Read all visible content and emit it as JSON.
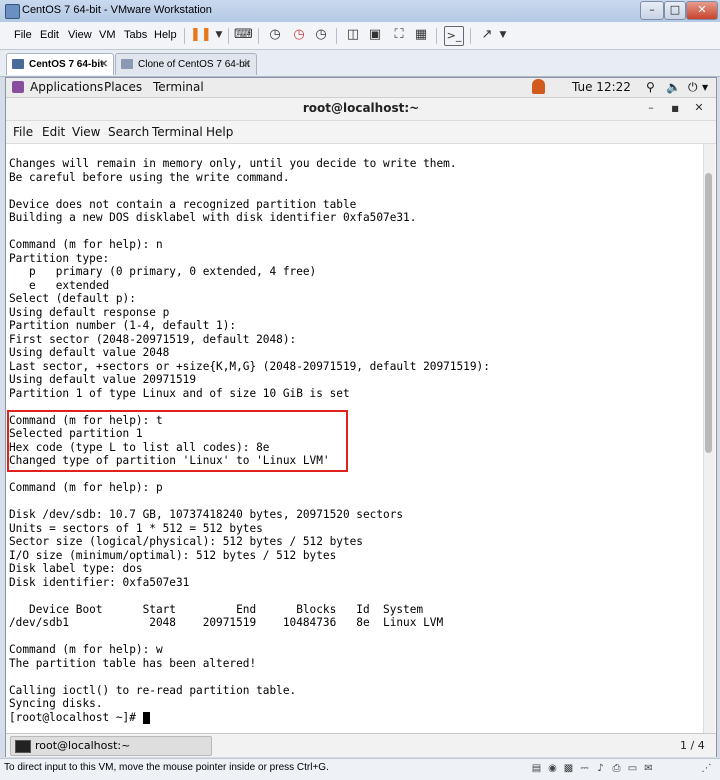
{
  "window": {
    "title": "CentOS 7 64-bit - VMware Workstation"
  },
  "vm_menu": [
    "File",
    "Edit",
    "View",
    "VM",
    "Tabs",
    "Help"
  ],
  "vm_tabs": [
    {
      "label": "CentOS 7 64-bit",
      "active": true
    },
    {
      "label": "Clone of CentOS 7 64-bit",
      "active": false
    }
  ],
  "gnome_bar": {
    "applications": "Applications",
    "places": "Places",
    "terminal": "Terminal",
    "clock": "Tue 12:22"
  },
  "terminal_window": {
    "title": "root@localhost:~",
    "menu": [
      "File",
      "Edit",
      "View",
      "Search",
      "Terminal",
      "Help"
    ]
  },
  "terminal_lines": [
    "Changes will remain in memory only, until you decide to write them.",
    "Be careful before using the write command.",
    "",
    "Device does not contain a recognized partition table",
    "Building a new DOS disklabel with disk identifier 0xfa507e31.",
    "",
    "Command (m for help): n",
    "Partition type:",
    "   p   primary (0 primary, 0 extended, 4 free)",
    "   e   extended",
    "Select (default p):",
    "Using default response p",
    "Partition number (1-4, default 1):",
    "First sector (2048-20971519, default 2048):",
    "Using default value 2048",
    "Last sector, +sectors or +size{K,M,G} (2048-20971519, default 20971519):",
    "Using default value 20971519",
    "Partition 1 of type Linux and of size 10 GiB is set",
    "",
    "Command (m for help): t",
    "Selected partition 1",
    "Hex code (type L to list all codes): 8e",
    "Changed type of partition 'Linux' to 'Linux LVM'",
    "",
    "Command (m for help): p",
    "",
    "Disk /dev/sdb: 10.7 GB, 10737418240 bytes, 20971520 sectors",
    "Units = sectors of 1 * 512 = 512 bytes",
    "Sector size (logical/physical): 512 bytes / 512 bytes",
    "I/O size (minimum/optimal): 512 bytes / 512 bytes",
    "Disk label type: dos",
    "Disk identifier: 0xfa507e31",
    "",
    "   Device Boot      Start         End      Blocks   Id  System",
    "/dev/sdb1            2048    20971519    10484736   8e  Linux LVM",
    "",
    "Command (m for help): w",
    "The partition table has been altered!",
    "",
    "Calling ioctl() to re-read partition table.",
    "Syncing disks.",
    "[root@localhost ~]#"
  ],
  "taskbar": {
    "item": "root@localhost:~",
    "workspace": "1 / 4"
  },
  "status_bar": {
    "text": "To direct input to this VM, move the mouse pointer inside or press Ctrl+G."
  },
  "colors": {
    "highlight": "#e0211c",
    "terminal_bg": "#ffffff",
    "terminal_fg": "#000000"
  }
}
